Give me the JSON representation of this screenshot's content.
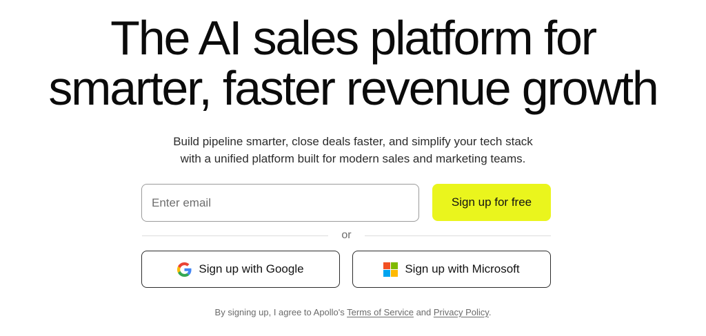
{
  "hero": {
    "headline_line1": "The AI sales platform for",
    "headline_line2": "smarter, faster revenue growth",
    "subhead_line1": "Build pipeline smarter, close deals faster, and simplify your tech stack",
    "subhead_line2": "with a unified platform built for modern sales and marketing teams."
  },
  "signup_form": {
    "email_placeholder": "Enter email",
    "email_value": "",
    "submit_label": "Sign up for free",
    "submit_color": "#eaf51d",
    "divider_text": "or",
    "google_label": "Sign up with Google",
    "google_icon": "google-g-icon",
    "microsoft_label": "Sign up with Microsoft",
    "microsoft_icon": "microsoft-logo-icon"
  },
  "legal": {
    "prefix": "By signing up, I agree to Apollo's ",
    "terms_label": "Terms of Service",
    "conjunction": " and ",
    "privacy_label": "Privacy Policy",
    "suffix": "."
  }
}
